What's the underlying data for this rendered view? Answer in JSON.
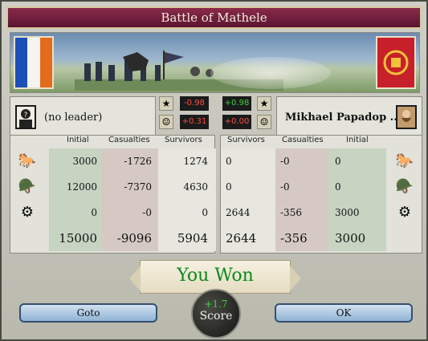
{
  "window": {
    "title": "Battle of Mathele"
  },
  "attacker": {
    "leader_name": "(no leader)",
    "modifiers": [
      {
        "value": "-0.98",
        "icon": "star-icon",
        "color": "#ff4d3c"
      },
      {
        "value": "+0.31",
        "icon": "general-icon",
        "color": "#ff4d3c"
      }
    ],
    "rows": [
      {
        "unit_icon": "cavalry-icon",
        "initial": "3000",
        "casualties": "-1726",
        "survivors": "1274"
      },
      {
        "unit_icon": "infantry-icon",
        "initial": "12000",
        "casualties": "-7370",
        "survivors": "4630"
      },
      {
        "unit_icon": "artillery-icon",
        "initial": "0",
        "casualties": "-0",
        "survivors": "0"
      }
    ],
    "totals": {
      "initial": "15000",
      "casualties": "-9096",
      "survivors": "5904"
    }
  },
  "defender": {
    "leader_name": "Mikhael Papadop ...",
    "modifiers": [
      {
        "value": "+0.98",
        "icon": "star-icon",
        "color": "#39d33a"
      },
      {
        "value": "+0.00",
        "icon": "general-icon",
        "color": "#ff4d3c"
      }
    ],
    "rows": [
      {
        "unit_icon": "cavalry-icon",
        "survivors": "0",
        "casualties": "-0",
        "initial": "0"
      },
      {
        "unit_icon": "infantry-icon",
        "survivors": "0",
        "casualties": "-0",
        "initial": "0"
      },
      {
        "unit_icon": "artillery-icon",
        "survivors": "2644",
        "casualties": "-356",
        "initial": "3000"
      }
    ],
    "totals": {
      "survivors": "2644",
      "casualties": "-356",
      "initial": "3000"
    }
  },
  "headers": {
    "initial": "Initial",
    "casualties": "Casualties",
    "survivors": "Survivors"
  },
  "result": {
    "label": "You Won"
  },
  "score": {
    "value": "+1.7",
    "label": "Score"
  },
  "buttons": {
    "goto": "Goto",
    "ok": "OK"
  }
}
